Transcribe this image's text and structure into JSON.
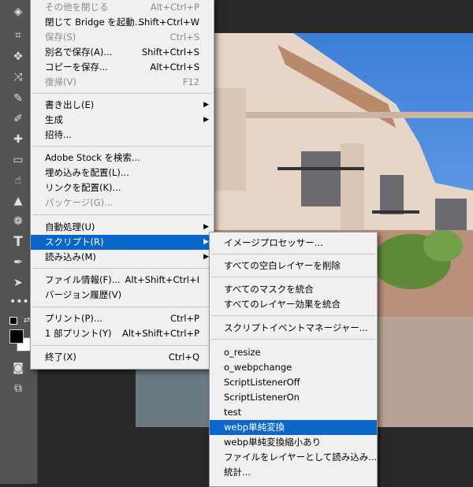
{
  "file_menu": {
    "items": [
      {
        "label": "その他を閉じる",
        "shortcut": "Alt+Ctrl+P",
        "disabled": true
      },
      {
        "label": "閉じて Bridge を起動...",
        "shortcut": "Shift+Ctrl+W"
      },
      {
        "label": "保存(S)",
        "shortcut": "Ctrl+S",
        "disabled": true
      },
      {
        "label": "別名で保存(A)...",
        "shortcut": "Shift+Ctrl+S"
      },
      {
        "label": "コピーを保存...",
        "shortcut": "Alt+Ctrl+S"
      },
      {
        "label": "復帰(V)",
        "shortcut": "F12",
        "disabled": true
      },
      {
        "label": "書き出し(E)",
        "submenu": true
      },
      {
        "label": "生成",
        "submenu": true
      },
      {
        "label": "招待..."
      },
      {
        "label": "Adobe Stock を検索..."
      },
      {
        "label": "埋め込みを配置(L)..."
      },
      {
        "label": "リンクを配置(K)..."
      },
      {
        "label": "パッケージ(G)...",
        "disabled": true
      },
      {
        "label": "自動処理(U)",
        "submenu": true
      },
      {
        "label": "スクリプト(R)",
        "submenu": true,
        "highlighted": true
      },
      {
        "label": "読み込み(M)",
        "submenu": true
      },
      {
        "label": "ファイル情報(F)...",
        "shortcut": "Alt+Shift+Ctrl+I"
      },
      {
        "label": "バージョン履歴(V)"
      },
      {
        "label": "プリント(P)...",
        "shortcut": "Ctrl+P"
      },
      {
        "label": "1 部プリント(Y)",
        "shortcut": "Alt+Shift+Ctrl+P"
      },
      {
        "label": "終了(X)",
        "shortcut": "Ctrl+Q"
      }
    ]
  },
  "script_menu": {
    "items": [
      {
        "label": "イメージプロセッサー..."
      },
      {
        "label": "すべての空白レイヤーを削除"
      },
      {
        "label": "すべてのマスクを統合"
      },
      {
        "label": "すべてのレイヤー効果を統合"
      },
      {
        "label": "スクリプトイベントマネージャー..."
      },
      {
        "label": "o_resize"
      },
      {
        "label": "o_webpchange"
      },
      {
        "label": "ScriptListenerOff"
      },
      {
        "label": "ScriptListenerOn"
      },
      {
        "label": "test"
      },
      {
        "label": "webp単純変換",
        "highlighted": true
      },
      {
        "label": "webp単純変換縮小あり"
      },
      {
        "label": "ファイルをレイヤーとして読み込み..."
      },
      {
        "label": "統計..."
      }
    ]
  },
  "colors": {
    "highlight": "#0a66c8",
    "menu_bg": "#f0f0f0",
    "toolbar_bg": "#535353",
    "canvas_bg": "#282828"
  },
  "toolbar_icons": [
    "eraser-icon",
    "crop-icon",
    "move-icon",
    "transform-icon",
    "eyedropper-icon",
    "brush-icon",
    "healing-icon",
    "gradient-icon",
    "smudge-icon",
    "shape-icon",
    "sponge-icon",
    "type-icon",
    "pen-icon",
    "selection-icon",
    "more-tools-icon",
    "default-colors-icon",
    "swap-colors-icon",
    "color-swatch",
    "quick-mask-icon",
    "screen-mode-icon"
  ]
}
